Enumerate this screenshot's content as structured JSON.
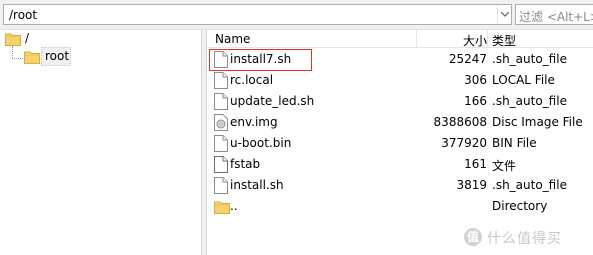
{
  "path_bar": {
    "path": "/root",
    "filter_placeholder": "过滤 <Alt+L>"
  },
  "tree": {
    "root_label": "/",
    "child_label": "root"
  },
  "list": {
    "columns": {
      "name": "Name",
      "size": "大小",
      "type": "类型"
    },
    "rows": [
      {
        "name": "install7.sh",
        "size": "25247",
        "type": ".sh_auto_file",
        "icon": "text-file-icon",
        "highlighted": true
      },
      {
        "name": "rc.local",
        "size": "306",
        "type": "LOCAL File",
        "icon": "text-file-icon"
      },
      {
        "name": "update_led.sh",
        "size": "166",
        "type": ".sh_auto_file",
        "icon": "text-file-icon"
      },
      {
        "name": "env.img",
        "size": "8388608",
        "type": "Disc Image File",
        "icon": "disc-image-icon"
      },
      {
        "name": "u-boot.bin",
        "size": "377920",
        "type": "BIN File",
        "icon": "text-file-icon"
      },
      {
        "name": "fstab",
        "size": "161",
        "type": "文件",
        "icon": "blank-file-icon"
      },
      {
        "name": "install.sh",
        "size": "3819",
        "type": ".sh_auto_file",
        "icon": "text-file-icon"
      },
      {
        "name": "..",
        "size": "",
        "type": "Directory",
        "icon": "folder-icon"
      }
    ]
  },
  "watermark": {
    "badge": "值",
    "text": "什么值得买"
  },
  "colors": {
    "folder": "#f5d36c",
    "highlight_border": "#d9362c"
  }
}
